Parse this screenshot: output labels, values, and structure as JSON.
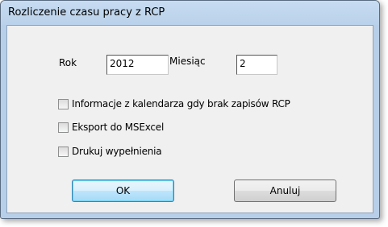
{
  "window": {
    "title": "Rozliczenie czasu pracy z RCP"
  },
  "form": {
    "year_label": "Rok",
    "year_value": "2012",
    "month_label": "Miesiąc",
    "month_value": "2"
  },
  "options": [
    {
      "label": "Informacje z kalendarza gdy brak zapisów RCP",
      "checked": false
    },
    {
      "label": "Eksport do MSExcel",
      "checked": false
    },
    {
      "label": "Drukuj wypełnienia",
      "checked": false
    }
  ],
  "buttons": {
    "ok_label": "OK",
    "cancel_label": "Anuluj"
  }
}
